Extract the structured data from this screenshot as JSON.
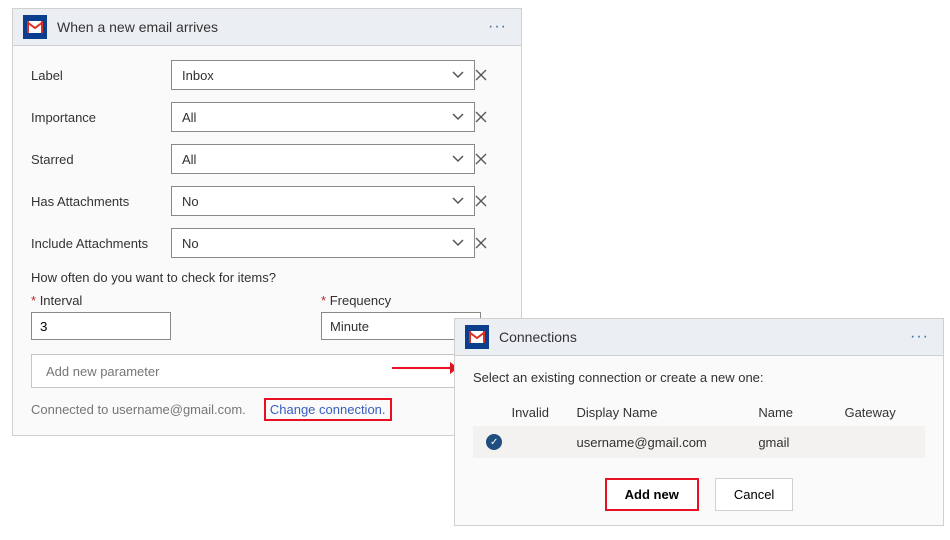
{
  "trigger": {
    "title": "When a new email arrives",
    "fields": [
      {
        "label": "Label",
        "value": "Inbox"
      },
      {
        "label": "Importance",
        "value": "All"
      },
      {
        "label": "Starred",
        "value": "All"
      },
      {
        "label": "Has Attachments",
        "value": "No"
      },
      {
        "label": "Include Attachments",
        "value": "No"
      }
    ],
    "recurrence_question": "How often do you want to check for items?",
    "interval_label": "Interval",
    "interval_value": "3",
    "frequency_label": "Frequency",
    "frequency_value": "Minute",
    "new_param_placeholder": "Add new parameter",
    "connected_text": "Connected to username@gmail.com.",
    "change_link": "Change connection."
  },
  "connections": {
    "title": "Connections",
    "desc": "Select an existing connection or create a new one:",
    "headers": {
      "invalid": "Invalid",
      "display_name": "Display Name",
      "name": "Name",
      "gateway": "Gateway"
    },
    "row": {
      "display_name": "username@gmail.com",
      "name": "gmail"
    },
    "add_new": "Add new",
    "cancel": "Cancel"
  }
}
